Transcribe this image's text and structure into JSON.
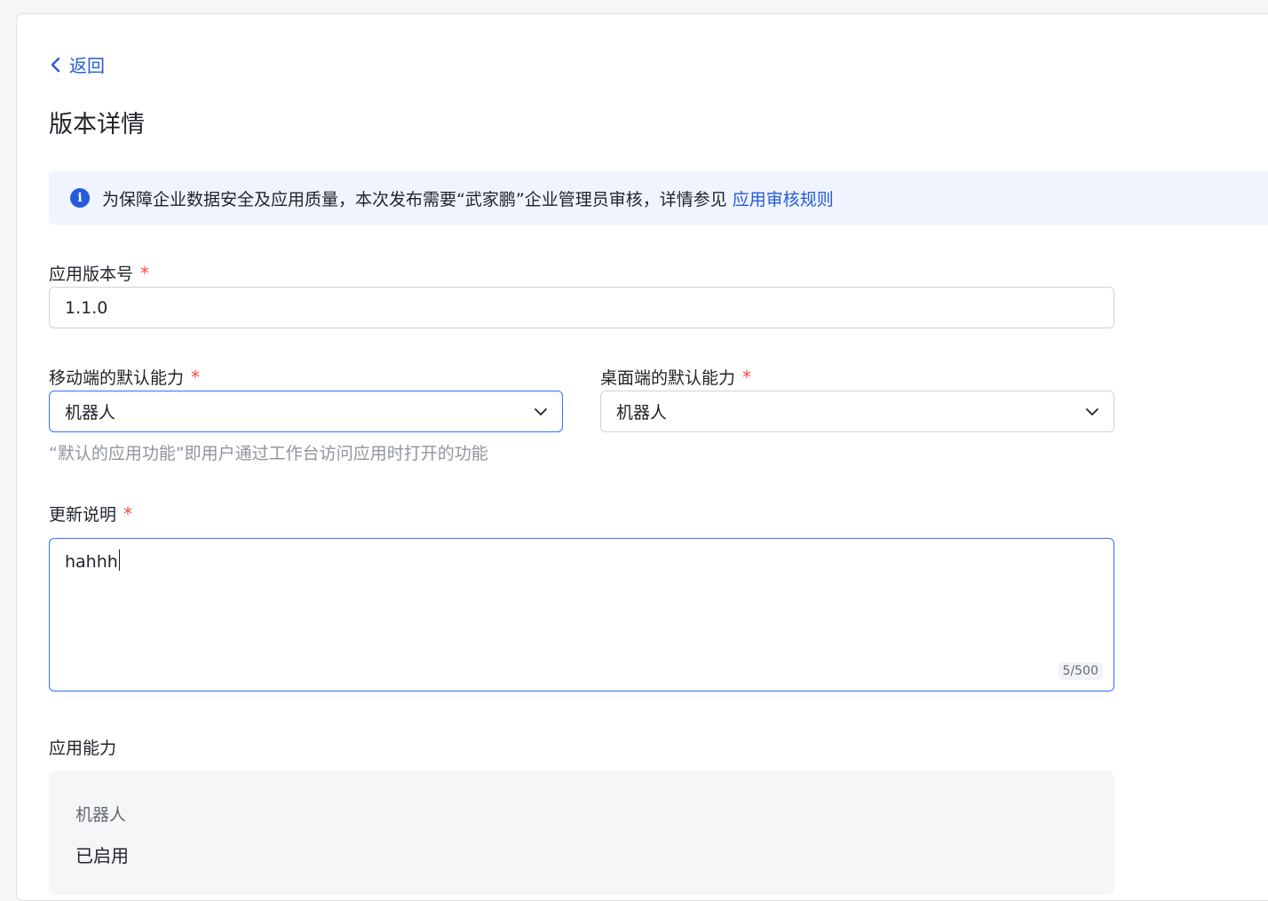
{
  "nav": {
    "back_label": "返回"
  },
  "page": {
    "title": "版本详情"
  },
  "notice": {
    "text": "为保障企业数据安全及应用质量，本次发布需要“武家鹏”企业管理员审核，详情参见",
    "link_label": "应用审核规则"
  },
  "form": {
    "version": {
      "label": "应用版本号",
      "required_mark": "*",
      "value": "1.1.0"
    },
    "mobile_default": {
      "label": "移动端的默认能力",
      "required_mark": "*",
      "value": "机器人"
    },
    "desktop_default": {
      "label": "桌面端的默认能力",
      "required_mark": "*",
      "value": "机器人"
    },
    "default_hint": "“默认的应用功能”即用户通过工作台访问应用时打开的功能",
    "release_notes": {
      "label": "更新说明",
      "required_mark": "*",
      "value": "hahhh",
      "counter": "5/500"
    }
  },
  "capabilities": {
    "section_title": "应用能力",
    "items": [
      {
        "name": "机器人",
        "status": "已启用"
      }
    ]
  },
  "colors": {
    "accent": "#245bdb",
    "focus_border": "#3370ff",
    "required": "#f54a45"
  }
}
